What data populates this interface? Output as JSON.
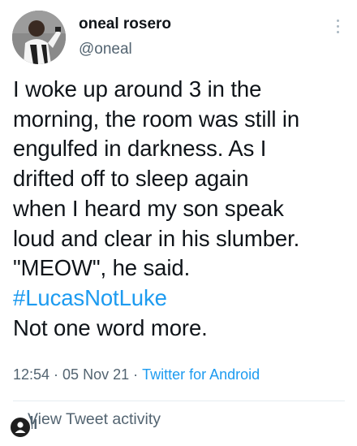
{
  "author": {
    "display_name": "oneal rosero",
    "handle": "@oneal"
  },
  "tweet": {
    "lines": [
      "I woke up around 3 in the",
      "morning, the room was still in",
      "engulfed in darkness. As I",
      "drifted off to sleep again",
      "when I heard my son speak",
      "loud and clear in his slumber.",
      "\"MEOW\", he said."
    ],
    "hashtag": "#LucasNotLuke",
    "closing": "Not one word more."
  },
  "meta": {
    "time": "12:54",
    "separator": "·",
    "date": "05 Nov 21",
    "source": "Twitter for Android"
  },
  "activity": {
    "label": "View Tweet activity"
  },
  "colors": {
    "link": "#1d9bf0",
    "secondary_text": "#536471",
    "text": "#0f1419"
  },
  "icons": {
    "more": "more-vertical-icon",
    "activity": "bar-chart-icon",
    "user_badge": "user-icon"
  }
}
